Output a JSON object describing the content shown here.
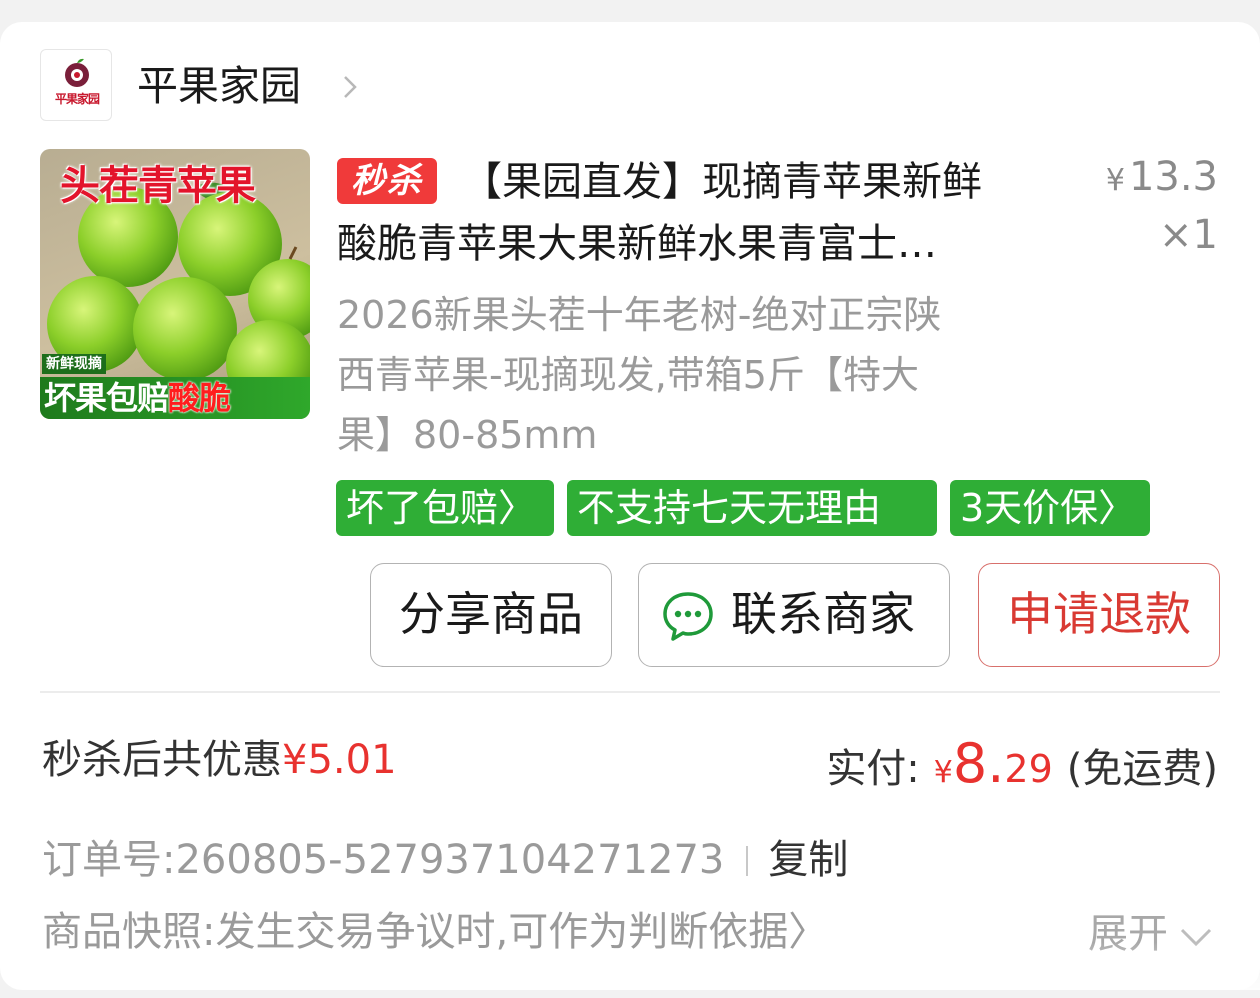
{
  "shop": {
    "logo_text": "平果家园",
    "name": "平果家园"
  },
  "product": {
    "image": {
      "title": "头茬青苹果",
      "sub_small": "新鲜现摘",
      "sub_big_prefix": "坏果包赔",
      "sub_big_highlight": "酸脆"
    },
    "badge": "秒杀",
    "title_line1": "【果园直发】现摘青苹果新鲜",
    "title_line2": "酸脆青苹果大果新鲜水果青富士…",
    "price_currency": "¥",
    "price": "13.3",
    "quantity": "×1",
    "spec_line1": "2026新果头茬十年老树-绝对正宗陕",
    "spec_line2": "西青苹果-现摘现发,带箱5斤【特大",
    "spec_line3": "果】80-85mm",
    "tags": [
      "坏了包赔〉",
      "不支持七天无理由",
      "3天价保〉"
    ]
  },
  "actions": {
    "share": "分享商品",
    "contact": "联系商家",
    "refund": "申请退款"
  },
  "summary": {
    "discount_label": "秒杀后共优惠",
    "discount_value": "¥5.01",
    "pay_label": "实付:",
    "pay_currency": "¥",
    "pay_integer": "8.",
    "pay_decimal": "29",
    "pay_note": "(免运费)"
  },
  "order": {
    "label": "订单号:",
    "number": "260805-527937104271273",
    "copy": "复制",
    "snapshot_text": "商品快照:发生交易争议时,可作为判断依据〉",
    "expand": "展开"
  },
  "colors": {
    "accent_red": "#e8322f",
    "tag_green": "#2fae36",
    "badge_red": "#f03a3a"
  }
}
